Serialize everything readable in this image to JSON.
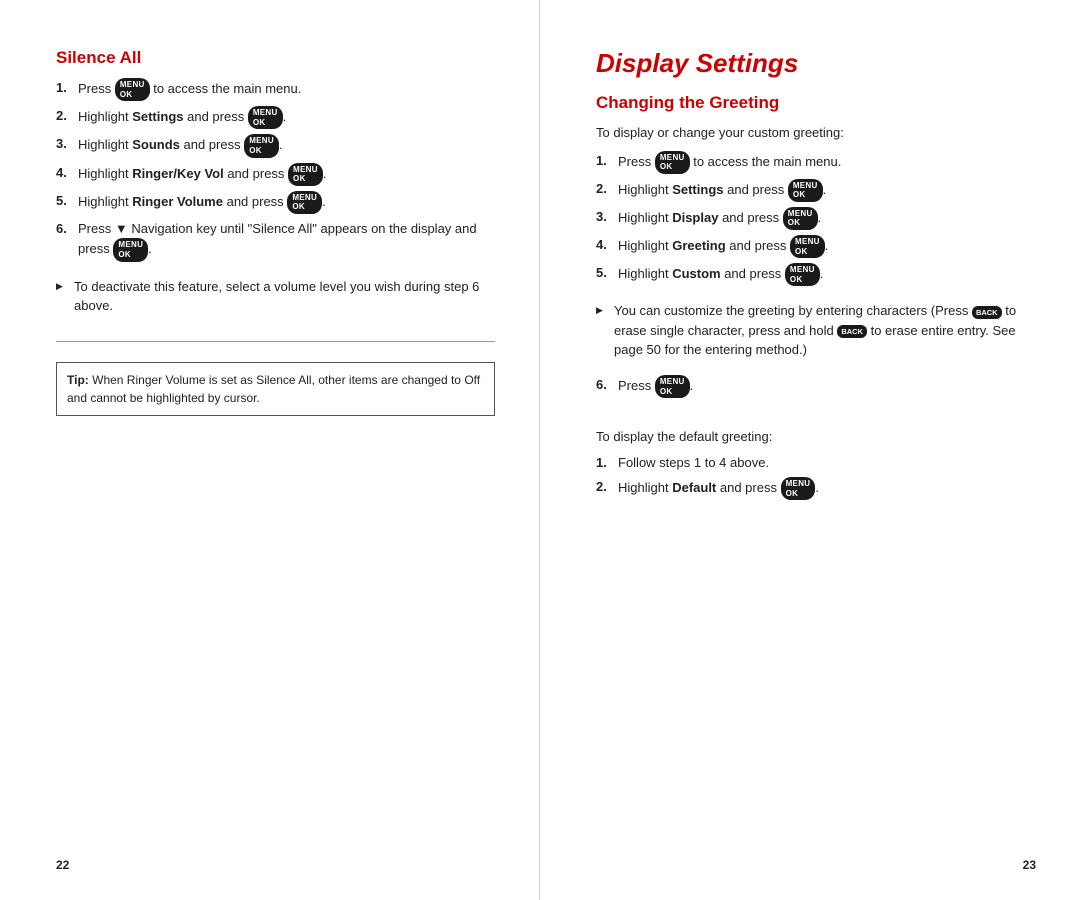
{
  "left_page": {
    "section": "Silence All",
    "page_number": "22",
    "steps": [
      {
        "id": 1,
        "text_before": "Press ",
        "btn": "MENU OK",
        "text_after": " to access the main menu."
      },
      {
        "id": 2,
        "highlight": "Settings",
        "text_before": "Highlight ",
        "text_after": " and press ",
        "btn": "MENU OK",
        "end": "."
      },
      {
        "id": 3,
        "highlight": "Sounds",
        "text_before": "Highlight ",
        "text_after": " and press ",
        "btn": "MENU OK",
        "end": "."
      },
      {
        "id": 4,
        "highlight": "Ringer/Key Vol",
        "text_before": "Highlight ",
        "text_after": " and press ",
        "btn": "MENU OK",
        "end": "."
      },
      {
        "id": 5,
        "highlight": "Ringer Volume",
        "text_before": "Highlight ",
        "text_after": " and press ",
        "btn": "MENU OK",
        "end": "."
      },
      {
        "id": 6,
        "text_before": "Press ",
        "nav_symbol": "▼",
        "text_middle": " Navigation key until \"Silence All\" appears on the display and press ",
        "btn": "MENU OK",
        "end": "."
      }
    ],
    "bullet_items": [
      "To deactivate this feature, select a volume level you wish during step 6 above."
    ],
    "tip": {
      "label": "Tip:",
      "text": " When Ringer Volume is set as Silence All, other items are changed to Off and cannot be highlighted by cursor."
    }
  },
  "right_page": {
    "section": "Display Settings",
    "subsection": "Changing the Greeting",
    "page_number": "23",
    "intro": "To display or change your custom greeting:",
    "steps": [
      {
        "id": 1,
        "text_before": "Press ",
        "btn": "MENU OK",
        "text_after": " to access the main menu."
      },
      {
        "id": 2,
        "highlight": "Settings",
        "text_before": "Highlight ",
        "text_after": " and press ",
        "btn": "MENU OK",
        "end": "."
      },
      {
        "id": 3,
        "highlight": "Display",
        "text_before": "Highlight ",
        "text_after": " and press ",
        "btn": "MENU OK",
        "end": "."
      },
      {
        "id": 4,
        "highlight": "Greeting",
        "text_before": "Highlight ",
        "text_after": " and press ",
        "btn": "MENU OK",
        "end": "."
      },
      {
        "id": 5,
        "highlight": "Custom",
        "text_before": "Highlight ",
        "text_after": " and press ",
        "btn": "MENU OK",
        "end": "."
      }
    ],
    "bullet_items": [
      "You can customize the greeting by entering characters (Press [BACK] to erase single character, press and hold [BACK] to erase entire entry. See page 50 for the entering method.)"
    ],
    "step6": "Press ",
    "step6_btn": "MENU OK",
    "step6_end": ".",
    "sub_intro": "To display the default greeting:",
    "sub_steps": [
      {
        "id": 1,
        "text": "Follow steps 1 to 4 above."
      },
      {
        "id": 2,
        "highlight": "Default",
        "text_before": "Highlight ",
        "text_after": " and press ",
        "btn": "MENU OK",
        "end": "."
      }
    ]
  }
}
